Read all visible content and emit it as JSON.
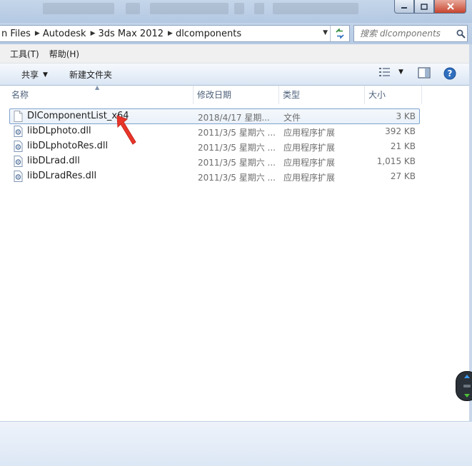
{
  "addressbar": {
    "crumbs": [
      "n Files",
      "Autodesk",
      "3ds Max 2012",
      "dlcomponents"
    ]
  },
  "search": {
    "placeholder": "搜索 dlcomponents"
  },
  "menu": {
    "tools": "工具(T)",
    "help": "帮助(H)"
  },
  "toolbar": {
    "share": "共享",
    "new_folder": "新建文件夹"
  },
  "columns": {
    "name": "名称",
    "date": "修改日期",
    "type": "类型",
    "size": "大小"
  },
  "files": [
    {
      "name": "DlComponentList_x64",
      "date": "2018/4/17 星期...",
      "type": "文件",
      "size": "3 KB",
      "icon": "document-icon"
    },
    {
      "name": "libDLphoto.dll",
      "date": "2011/3/5 星期六 ...",
      "type": "应用程序扩展",
      "size": "392 KB",
      "icon": "dll-icon"
    },
    {
      "name": "libDLphotoRes.dll",
      "date": "2011/3/5 星期六 ...",
      "type": "应用程序扩展",
      "size": "21 KB",
      "icon": "dll-icon"
    },
    {
      "name": "libDLrad.dll",
      "date": "2011/3/5 星期六 ...",
      "type": "应用程序扩展",
      "size": "1,015 KB",
      "icon": "dll-icon"
    },
    {
      "name": "libDLradRes.dll",
      "date": "2011/3/5 星期六 ...",
      "type": "应用程序扩展",
      "size": "27 KB",
      "icon": "dll-icon"
    }
  ],
  "colors": {
    "accent": "#2f6fbf",
    "annotation_arrow": "#e8352a",
    "selection_border": "#7da2ce"
  }
}
